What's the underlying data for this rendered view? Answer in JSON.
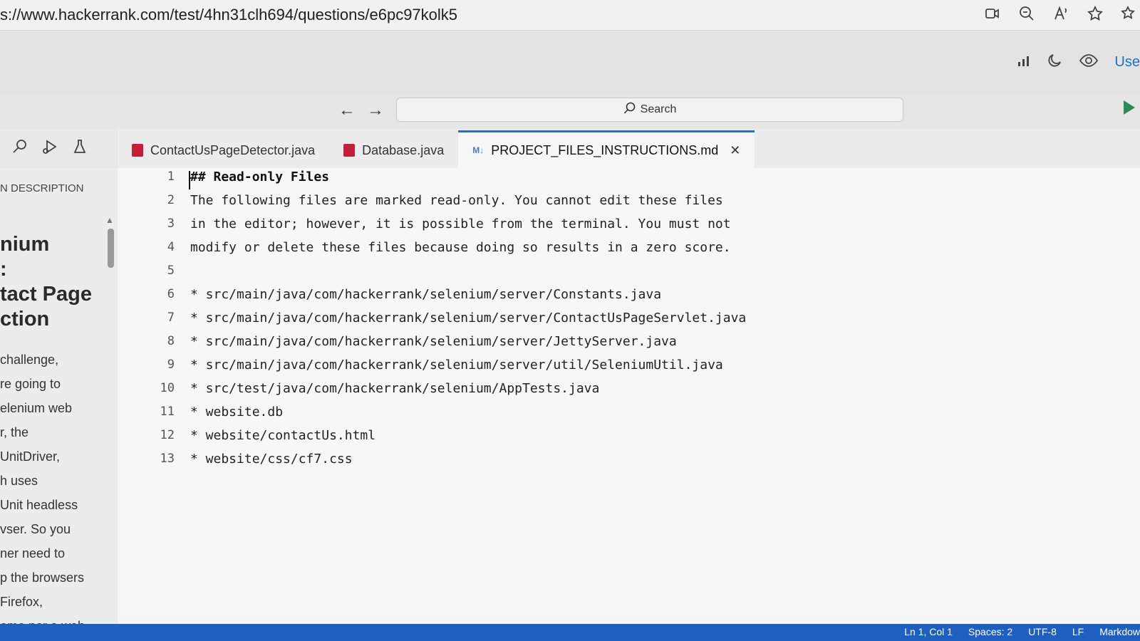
{
  "browser": {
    "url": "s://www.hackerrank.com/test/4hn31clh694/questions/e6pc97kolk5"
  },
  "header": {
    "user_link": "Use"
  },
  "ide": {
    "search_label": "Search"
  },
  "tabs": [
    {
      "label": "ContactUsPageDetector.java",
      "icon": "java-file-icon"
    },
    {
      "label": "Database.java",
      "icon": "java-file-icon"
    },
    {
      "label": "PROJECT_FILES_INSTRUCTIONS.md",
      "icon": "markdown-file-icon",
      "active": true
    }
  ],
  "left_panel": {
    "header": "N DESCRIPTION",
    "title_lines": [
      "nium",
      ":",
      "tact Page",
      "ction"
    ],
    "body_lines": [
      "challenge,",
      "re going to",
      "elenium web",
      "r, the",
      "UnitDriver,",
      "h uses",
      "Unit headless",
      "vser. So you",
      "ner need to",
      "p the browsers",
      "Firefox,",
      "ome nor a web"
    ]
  },
  "editor": {
    "lines": [
      {
        "n": "1",
        "text": "## Read-only Files"
      },
      {
        "n": "2",
        "text": "The following files are marked read-only. You cannot edit these files"
      },
      {
        "n": "3",
        "text": "in the editor; however, it is possible from the terminal. You must not"
      },
      {
        "n": "4",
        "text": "modify or delete these files because doing so results in a zero score."
      },
      {
        "n": "5",
        "text": ""
      },
      {
        "n": "6",
        "text": "* src/main/java/com/hackerrank/selenium/server/Constants.java"
      },
      {
        "n": "7",
        "text": "* src/main/java/com/hackerrank/selenium/server/ContactUsPageServlet.java"
      },
      {
        "n": "8",
        "text": "* src/main/java/com/hackerrank/selenium/server/JettyServer.java"
      },
      {
        "n": "9",
        "text": "* src/main/java/com/hackerrank/selenium/server/util/SeleniumUtil.java"
      },
      {
        "n": "10",
        "text": "* src/test/java/com/hackerrank/selenium/AppTests.java"
      },
      {
        "n": "11",
        "text": "* website.db"
      },
      {
        "n": "12",
        "text": "* website/contactUs.html"
      },
      {
        "n": "13",
        "text": "* website/css/cf7.css"
      }
    ]
  },
  "status": {
    "position": "Ln 1, Col 1",
    "spaces": "Spaces: 2",
    "encoding": "UTF-8",
    "eol": "LF",
    "language": "Markdow"
  },
  "colors": {
    "accent": "#1a6fd1",
    "status_bar": "#1f5fbf",
    "java_icon": "#c41e3a",
    "run_green": "#2e8b57"
  }
}
